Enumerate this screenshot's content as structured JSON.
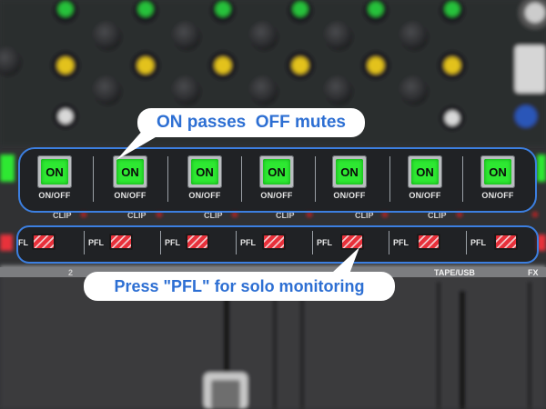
{
  "callouts": {
    "on_off": "ON passes  OFF mutes",
    "pfl": "Press \"PFL\" for solo monitoring"
  },
  "mute_buttons": [
    {
      "label": "ON",
      "caption": "ON/OFF",
      "state": "on"
    },
    {
      "label": "ON",
      "caption": "ON/OFF",
      "state": "on"
    },
    {
      "label": "ON",
      "caption": "ON/OFF",
      "state": "on"
    },
    {
      "label": "ON",
      "caption": "ON/OFF",
      "state": "on"
    },
    {
      "label": "ON",
      "caption": "ON/OFF",
      "state": "on"
    },
    {
      "label": "ON",
      "caption": "ON/OFF",
      "state": "on"
    },
    {
      "label": "ON",
      "caption": "ON/OFF",
      "state": "on"
    }
  ],
  "pfl_buttons": [
    {
      "label": "FL"
    },
    {
      "label": "PFL"
    },
    {
      "label": "PFL"
    },
    {
      "label": "PFL"
    },
    {
      "label": "PFL"
    },
    {
      "label": "PFL"
    },
    {
      "label": "PFL"
    }
  ],
  "clip_labels": [
    "CLIP",
    "CLIP",
    "CLIP",
    "CLIP",
    "CLIP",
    "CLIP"
  ],
  "channel_labels": [
    "2",
    "TAPE/USB",
    "FX"
  ],
  "colors": {
    "annotation_border": "#3c7fe0",
    "callout_text": "#2d6fd3",
    "on_lamp": "#2ee832",
    "pfl_lamp": "#e8303a"
  }
}
